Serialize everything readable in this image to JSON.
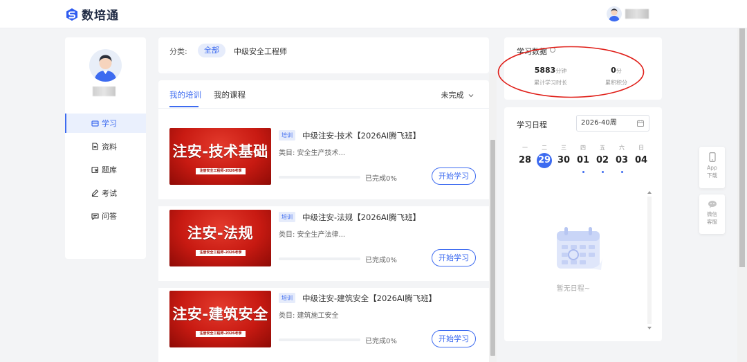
{
  "app": {
    "name": "数培通",
    "brand_color": "#3d6bf0"
  },
  "sidebar": {
    "items": [
      {
        "label": "学习",
        "icon": "study-icon",
        "active": true
      },
      {
        "label": "资料",
        "icon": "document-icon",
        "active": false
      },
      {
        "label": "题库",
        "icon": "question-bank-icon",
        "active": false
      },
      {
        "label": "考试",
        "icon": "exam-pen-icon",
        "active": false
      },
      {
        "label": "问答",
        "icon": "qa-chat-icon",
        "active": false
      }
    ]
  },
  "filter": {
    "label": "分类:",
    "selected": "全部",
    "option": "中级安全工程师"
  },
  "tabs": [
    {
      "label": "我的培训",
      "active": true
    },
    {
      "label": "我的课程",
      "active": false
    }
  ],
  "status_filter": "未完成",
  "courses": [
    {
      "cover_title": "注安-技术基础",
      "cover_sub": "注册安全工程师-2026考季",
      "tag": "培训",
      "title": "中级注安-技术【2026AI腾飞班】",
      "category": "类目: 安全生产技术...",
      "progress": 0,
      "progress_text": "已完成0%",
      "button": "开始学习"
    },
    {
      "cover_title": "注安-法规",
      "cover_sub": "注册安全工程师-2026考季",
      "tag": "培训",
      "title": "中级注安-法规【2026AI腾飞班】",
      "category": "类目: 安全生产法律...",
      "progress": 0,
      "progress_text": "已完成0%",
      "button": "开始学习"
    },
    {
      "cover_title": "注安-建筑安全",
      "cover_sub": "注册安全工程师-2026考季",
      "tag": "培训",
      "title": "中级注安-建筑安全【2026AI腾飞班】",
      "category": "类目: 建筑施工安全",
      "progress": 0,
      "progress_text": "已完成0%",
      "button": "开始学习"
    }
  ],
  "study_data": {
    "title": "学习数据",
    "duration_value": "5883",
    "duration_unit": "分钟",
    "duration_label": "累计学习时长",
    "points_value": "0",
    "points_unit": "分",
    "points_label": "累积积分"
  },
  "schedule": {
    "title": "学习日程",
    "week": "2026-40周",
    "days": [
      {
        "dow": "一",
        "num": "28",
        "today": false,
        "has_event": false
      },
      {
        "dow": "二",
        "num": "29",
        "today": true,
        "has_event": false
      },
      {
        "dow": "三",
        "num": "30",
        "today": false,
        "has_event": false
      },
      {
        "dow": "四",
        "num": "01",
        "today": false,
        "has_event": true
      },
      {
        "dow": "五",
        "num": "02",
        "today": false,
        "has_event": true
      },
      {
        "dow": "六",
        "num": "03",
        "today": false,
        "has_event": true
      },
      {
        "dow": "日",
        "num": "04",
        "today": false,
        "has_event": false
      }
    ],
    "empty_text": "暂无日程~"
  },
  "float_tools": [
    {
      "label1": "App",
      "label2": "下载",
      "icon": "phone-icon"
    },
    {
      "label1": "微信",
      "label2": "客服",
      "icon": "wechat-icon"
    }
  ]
}
